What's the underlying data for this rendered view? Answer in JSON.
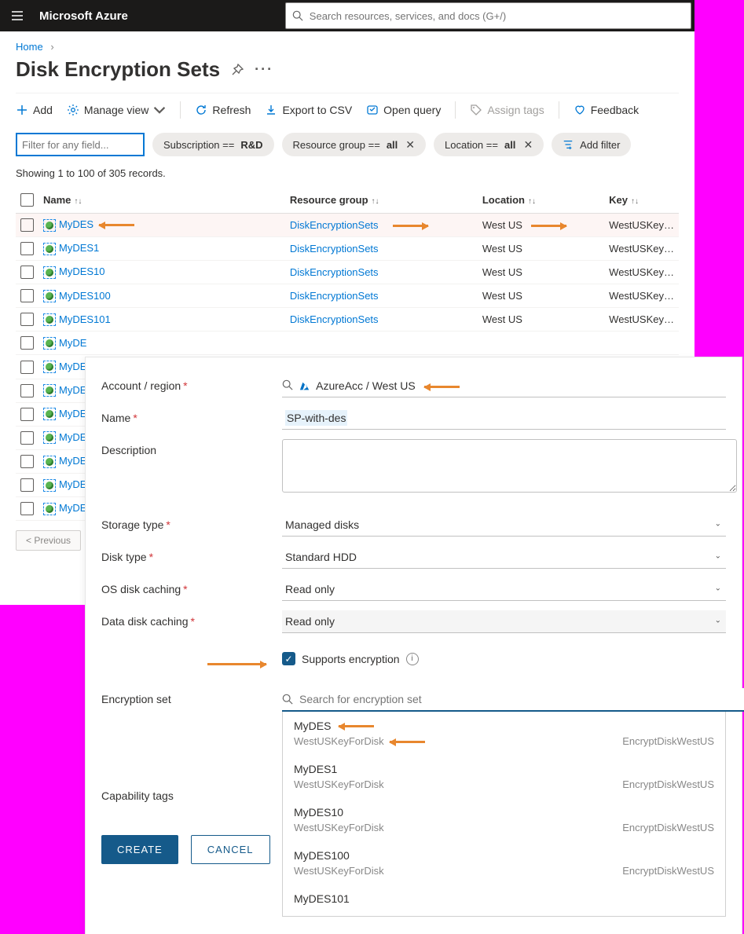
{
  "header": {
    "brand": "Microsoft Azure",
    "search_placeholder": "Search resources, services, and docs (G+/)"
  },
  "breadcrumb": {
    "home": "Home"
  },
  "page_title": "Disk Encryption Sets",
  "toolbar": {
    "add": "Add",
    "manage_view": "Manage view",
    "refresh": "Refresh",
    "export_csv": "Export to CSV",
    "open_query": "Open query",
    "assign_tags": "Assign tags",
    "feedback": "Feedback"
  },
  "filters": {
    "placeholder": "Filter for any field...",
    "subscription_label": "Subscription == ",
    "subscription_value": "R&D",
    "rg_label": "Resource group == ",
    "rg_value": "all",
    "loc_label": "Location == ",
    "loc_value": "all",
    "add_filter": "Add filter"
  },
  "records_line": "Showing 1 to 100 of 305 records.",
  "columns": {
    "name": "Name",
    "rg": "Resource group",
    "loc": "Location",
    "key": "Key"
  },
  "rows": [
    {
      "name": "MyDES",
      "rg": "DiskEncryptionSets",
      "loc": "West US",
      "key": "WestUSKey…",
      "hi": true,
      "arrow_name": true,
      "arrow_loc": true,
      "arrow_key": true
    },
    {
      "name": "MyDES1",
      "rg": "DiskEncryptionSets",
      "loc": "West US",
      "key": "WestUSKey…"
    },
    {
      "name": "MyDES10",
      "rg": "DiskEncryptionSets",
      "loc": "West US",
      "key": "WestUSKey…"
    },
    {
      "name": "MyDES100",
      "rg": "DiskEncryptionSets",
      "loc": "West US",
      "key": "WestUSKey…"
    },
    {
      "name": "MyDES101",
      "rg": "DiskEncryptionSets",
      "loc": "West US",
      "key": "WestUSKey…"
    },
    {
      "name": "MyDE",
      "rg": "",
      "loc": "",
      "key": ""
    },
    {
      "name": "MyDE",
      "rg": "",
      "loc": "",
      "key": ""
    },
    {
      "name": "MyDE",
      "rg": "",
      "loc": "",
      "key": ""
    },
    {
      "name": "MyDE",
      "rg": "",
      "loc": "",
      "key": ""
    },
    {
      "name": "MyDE",
      "rg": "",
      "loc": "",
      "key": ""
    },
    {
      "name": "MyDE",
      "rg": "",
      "loc": "",
      "key": ""
    },
    {
      "name": "MyDE",
      "rg": "",
      "loc": "",
      "key": ""
    },
    {
      "name": "MyDE",
      "rg": "",
      "loc": "",
      "key": ""
    }
  ],
  "prev_btn": "< Previous",
  "panel": {
    "account_label": "Account / region",
    "account_value": "AzureAcc / West US",
    "name_label": "Name",
    "name_value": "SP-with-des",
    "desc_label": "Description",
    "storage_label": "Storage type",
    "storage_value": "Managed disks",
    "disk_type_label": "Disk type",
    "disk_type_value": "Standard HDD",
    "os_cache_label": "OS disk caching",
    "os_cache_value": "Read only",
    "data_cache_label": "Data disk caching",
    "data_cache_value": "Read only",
    "supports_enc": "Supports encryption",
    "enc_set_label": "Encryption set",
    "enc_search_placeholder": "Search for encryption set",
    "cap_tags": "Capability tags",
    "create": "CREATE",
    "cancel": "CANCEL",
    "options": [
      {
        "name": "MyDES",
        "key": "WestUSKeyForDisk",
        "vault": "EncryptDiskWestUS",
        "arrow": true
      },
      {
        "name": "MyDES1",
        "key": "WestUSKeyForDisk",
        "vault": "EncryptDiskWestUS"
      },
      {
        "name": "MyDES10",
        "key": "WestUSKeyForDisk",
        "vault": "EncryptDiskWestUS"
      },
      {
        "name": "MyDES100",
        "key": "WestUSKeyForDisk",
        "vault": "EncryptDiskWestUS"
      },
      {
        "name": "MyDES101",
        "key": "",
        "vault": ""
      }
    ]
  }
}
